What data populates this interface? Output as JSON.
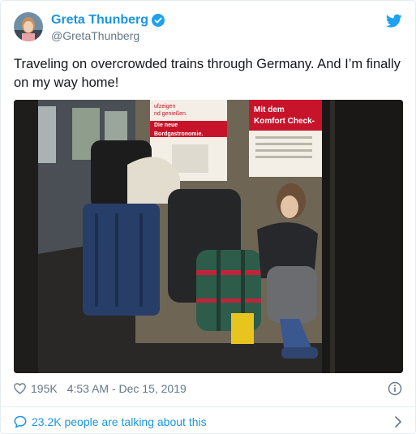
{
  "tweet": {
    "display_name": "Greta Thunberg",
    "handle": "@GretaThunberg",
    "verified_icon": "verified-badge-icon",
    "logo_icon": "twitter-bird-icon",
    "text": "Traveling on overcrowded trains through Germany. And I’m finally on my way home!",
    "likes": "195K",
    "timestamp": "4:53 AM - Dec 15, 2019",
    "talking": "23.2K people are talking about this",
    "brand_color": "#1b95e0",
    "muted_color": "#657786"
  },
  "photo": {
    "sign_left_line1": "ufzeigen",
    "sign_left_line2": "nd genießen.",
    "sign_left_line3": "Die neue",
    "sign_left_line4": "Bordgastronomie.",
    "sign_right_line1": "Mit dem",
    "sign_right_line2": "Komfort Check-"
  }
}
